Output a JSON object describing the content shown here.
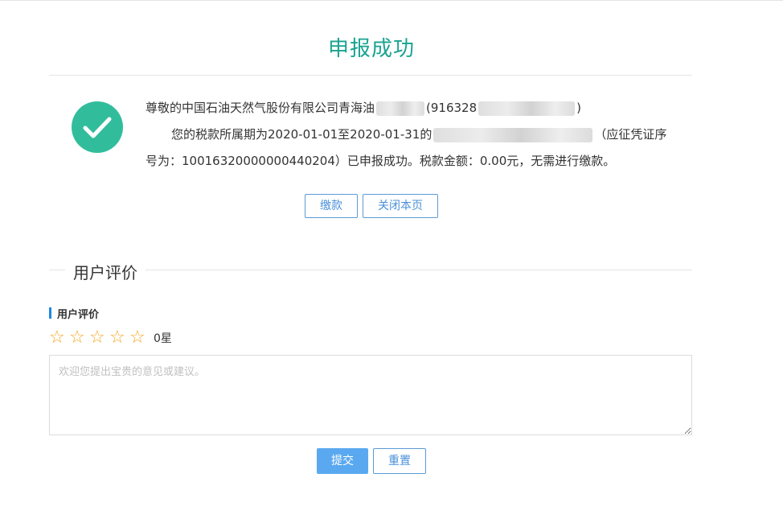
{
  "page": {
    "title": "申报成功"
  },
  "result": {
    "line1_text": "尊敬的中国石油天然气股份有限公司青海油",
    "line1_tail": "(916328",
    "line1_close": ")",
    "line2_text": "您的税款所属期为2020-01-01至2020-01-31的",
    "line2_tail": "（应征凭证序",
    "line3_text": "号为：10016320000000440204）已申报成功。税款金额：0.00元，无需进行缴款。"
  },
  "actions": {
    "pay_label": "缴款",
    "close_label": "关闭本页"
  },
  "evaluation": {
    "section_title": "用户评价",
    "sub_label": "用户评价",
    "stars_total": 5,
    "rating": "0星",
    "feedback_placeholder": "欢迎您提出宝贵的意见或建议。",
    "submit_label": "提交",
    "reset_label": "重置"
  },
  "colors": {
    "title": "#1aa391",
    "check_circle": "#31bd9c",
    "star": "#f5a623",
    "primary_button": "#5aa9f0",
    "accent_bar": "#1e88e5"
  },
  "icons": {
    "success": "check-circle-icon",
    "star": "star-outline-icon"
  }
}
